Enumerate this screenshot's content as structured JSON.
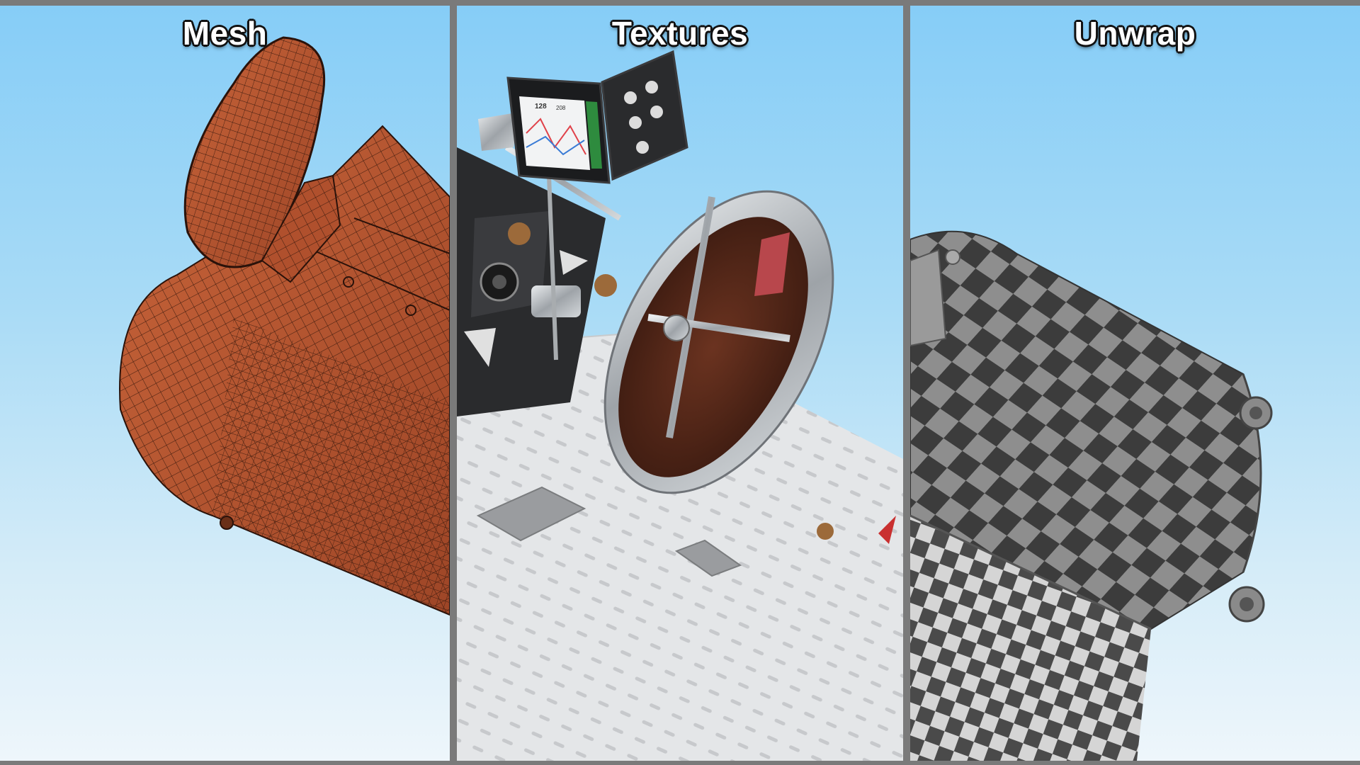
{
  "panels": [
    {
      "id": "mesh",
      "label": "Mesh"
    },
    {
      "id": "textures",
      "label": "Textures"
    },
    {
      "id": "unwrap",
      "label": "Unwrap"
    }
  ],
  "screen_readout": {
    "value_a": "128",
    "value_b": "208"
  },
  "colors": {
    "frame": "#7a7a7a",
    "sky_top": "#86cdf7",
    "sky_bottom": "#eef6fb",
    "mesh_fill": "#b4532f",
    "mesh_wire": "#3a1a0e",
    "body_white": "#e4e6e8",
    "steel": "#b9bdc1",
    "coffee": "#5a2b1a",
    "checker_dark": "#3c3c3c",
    "checker_light": "#8e8e8e"
  }
}
